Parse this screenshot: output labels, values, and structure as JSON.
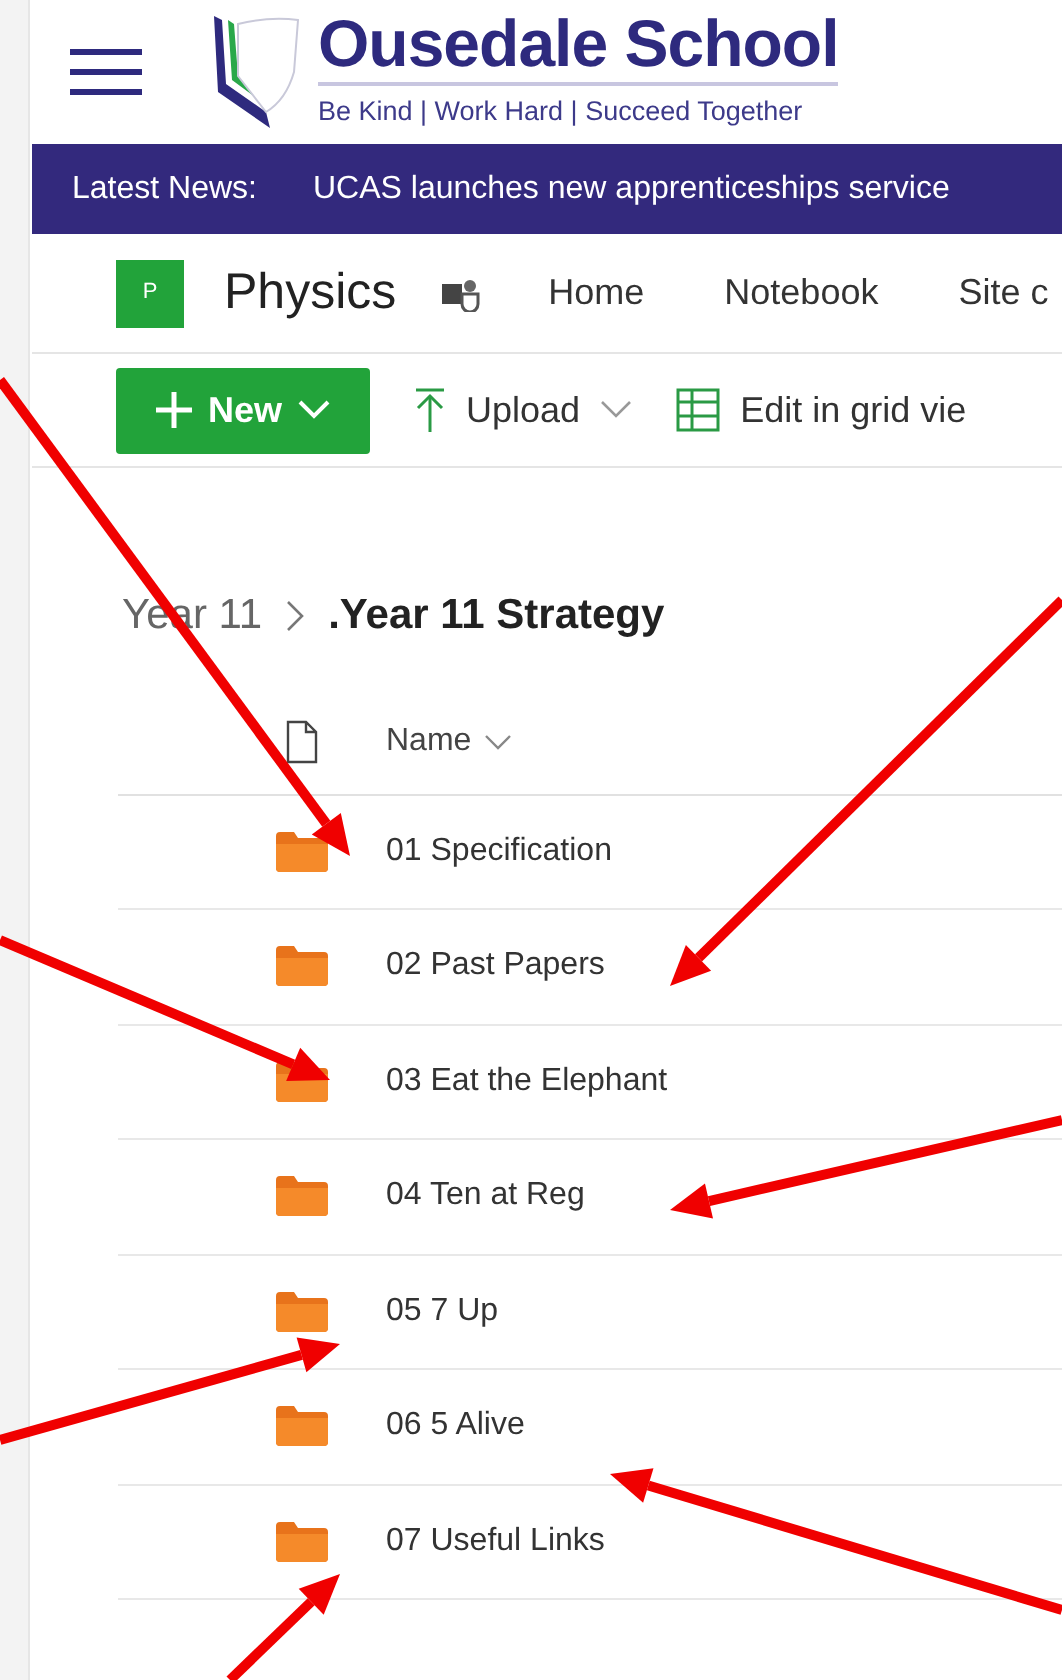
{
  "header": {
    "school_name": "Ousedale School",
    "motto": "Be Kind | Work Hard | Succeed Together"
  },
  "news": {
    "label": "Latest News:",
    "headline": "UCAS launches new apprenticeships service"
  },
  "site": {
    "initial": "P",
    "title": "Physics",
    "nav": [
      "Home",
      "Notebook",
      "Site c"
    ]
  },
  "toolbar": [
    {
      "kind": "primary",
      "label": "New"
    },
    {
      "kind": "upload",
      "label": "Upload"
    },
    {
      "kind": "grid",
      "label": "Edit in grid vie"
    }
  ],
  "breadcrumb": [
    {
      "label": "Year 11",
      "current": false
    },
    {
      "label": ".Year 11 Strategy",
      "current": true
    }
  ],
  "table": {
    "columns": [
      "Name"
    ],
    "rows": [
      {
        "name": "01 Specification"
      },
      {
        "name": "02 Past Papers"
      },
      {
        "name": "03 Eat the Elephant"
      },
      {
        "name": "04 Ten at Reg"
      },
      {
        "name": "05 7 Up"
      },
      {
        "name": "06 5 Alive"
      },
      {
        "name": "07 Useful Links"
      }
    ]
  }
}
